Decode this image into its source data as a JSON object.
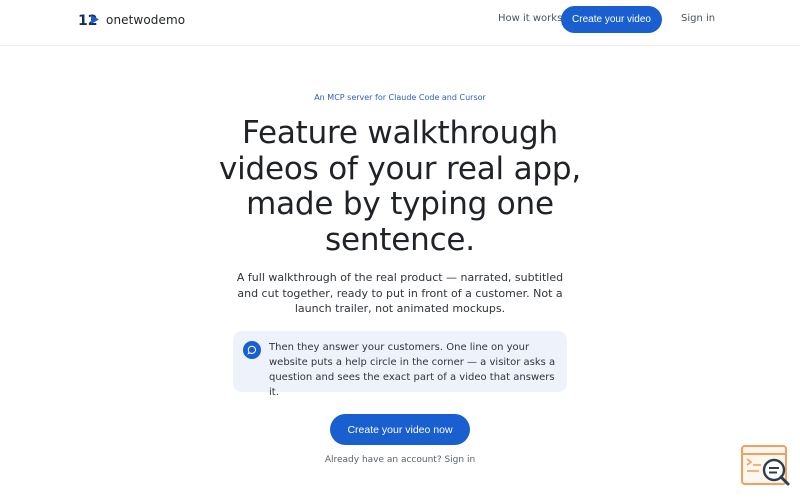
{
  "brand": {
    "name": "onetwodemo",
    "logo_text": "12"
  },
  "nav": {
    "how_it_works": "How it works",
    "create_video": "Create your video",
    "sign_in": "Sign in"
  },
  "hero": {
    "eyebrow": "An MCP server for Claude Code and Cursor",
    "headline": "Feature walkthrough videos of your real app, made by typing one sentence.",
    "subtext": "A full walkthrough of the real product — narrated, subtitled and cut together, ready to put in front of a customer. Not a launch trailer, not animated mockups.",
    "callout": "Then they answer your customers. One line on your website puts a help circle in the corner — a visitor asks a question and sees the exact part of a video that answers it.",
    "cta": "Create your video now",
    "already": "Already have an account? Sign in"
  },
  "icons": {
    "logo": "play-logo-icon",
    "callout": "chat-bubble-icon",
    "widget": "help-search-icon"
  },
  "colors": {
    "primary": "#1a5fd0",
    "callout_bg": "#eef3fb",
    "widget_accent": "#f0a060"
  }
}
